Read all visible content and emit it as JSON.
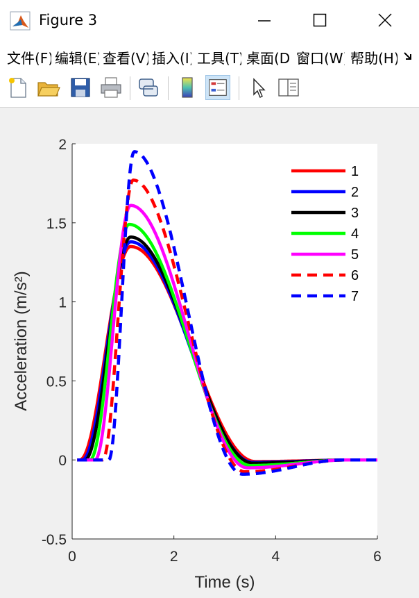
{
  "window": {
    "title": "Figure 3"
  },
  "menu": {
    "items": [
      "文件(F)",
      "编辑(E)",
      "查看(V)",
      "插入(I)",
      "工具(T)",
      "桌面(D)",
      "窗口(W)",
      "帮助(H)"
    ],
    "overflow_icon": "chevron-more-icon"
  },
  "toolbar": {
    "buttons": [
      {
        "name": "new-figure",
        "icon": "new-file-icon"
      },
      {
        "name": "open-file",
        "icon": "folder-open-icon"
      },
      {
        "name": "save-figure",
        "icon": "save-disk-icon"
      },
      {
        "name": "print-figure",
        "icon": "printer-icon"
      },
      {
        "name": "link-plot",
        "icon": "link-plot-icon"
      },
      {
        "name": "insert-colorbar",
        "icon": "colorbar-icon"
      },
      {
        "name": "insert-legend",
        "icon": "legend-icon",
        "active": true
      },
      {
        "name": "edit-plot",
        "icon": "pointer-arrow-icon"
      },
      {
        "name": "property-inspector",
        "icon": "property-inspector-icon"
      }
    ]
  },
  "chart_data": {
    "type": "line",
    "xlabel": "Time (s)",
    "ylabel": "Acceleration (m/s²)",
    "xlim": [
      0,
      6
    ],
    "ylim": [
      -0.5,
      2
    ],
    "xticks": [
      0,
      2,
      4,
      6
    ],
    "yticks": [
      -0.5,
      0,
      0.5,
      1,
      1.5,
      2
    ],
    "xtick_labels": [
      "0",
      "2",
      "4",
      "6"
    ],
    "ytick_labels": [
      "-0.5",
      "0",
      "0.5",
      "1",
      "1.5",
      "2"
    ],
    "grid": false,
    "legend_position": "top-right",
    "x_end": 6,
    "series": [
      {
        "name": "1",
        "color": "#ff0000",
        "dash": "solid",
        "onset": 0.15,
        "peak_t": 1.15,
        "peak": 1.35,
        "trough_t": 3.6,
        "trough": -0.01
      },
      {
        "name": "2",
        "color": "#0000ff",
        "dash": "solid",
        "onset": 0.2,
        "peak_t": 1.15,
        "peak": 1.38,
        "trough_t": 3.55,
        "trough": -0.015
      },
      {
        "name": "3",
        "color": "#000000",
        "dash": "solid",
        "onset": 0.25,
        "peak_t": 1.15,
        "peak": 1.41,
        "trough_t": 3.55,
        "trough": -0.02
      },
      {
        "name": "4",
        "color": "#00ff00",
        "dash": "solid",
        "onset": 0.35,
        "peak_t": 1.12,
        "peak": 1.49,
        "trough_t": 3.5,
        "trough": -0.035
      },
      {
        "name": "5",
        "color": "#ff00ff",
        "dash": "solid",
        "onset": 0.45,
        "peak_t": 1.15,
        "peak": 1.61,
        "trough_t": 3.45,
        "trough": -0.05
      },
      {
        "name": "6",
        "color": "#ff0000",
        "dash": "dashed",
        "onset": 0.6,
        "peak_t": 1.2,
        "peak": 1.77,
        "trough_t": 3.4,
        "trough": -0.075
      },
      {
        "name": "7",
        "color": "#0000ff",
        "dash": "dashed",
        "onset": 0.72,
        "peak_t": 1.22,
        "peak": 1.95,
        "trough_t": 3.35,
        "trough": -0.09
      }
    ]
  }
}
